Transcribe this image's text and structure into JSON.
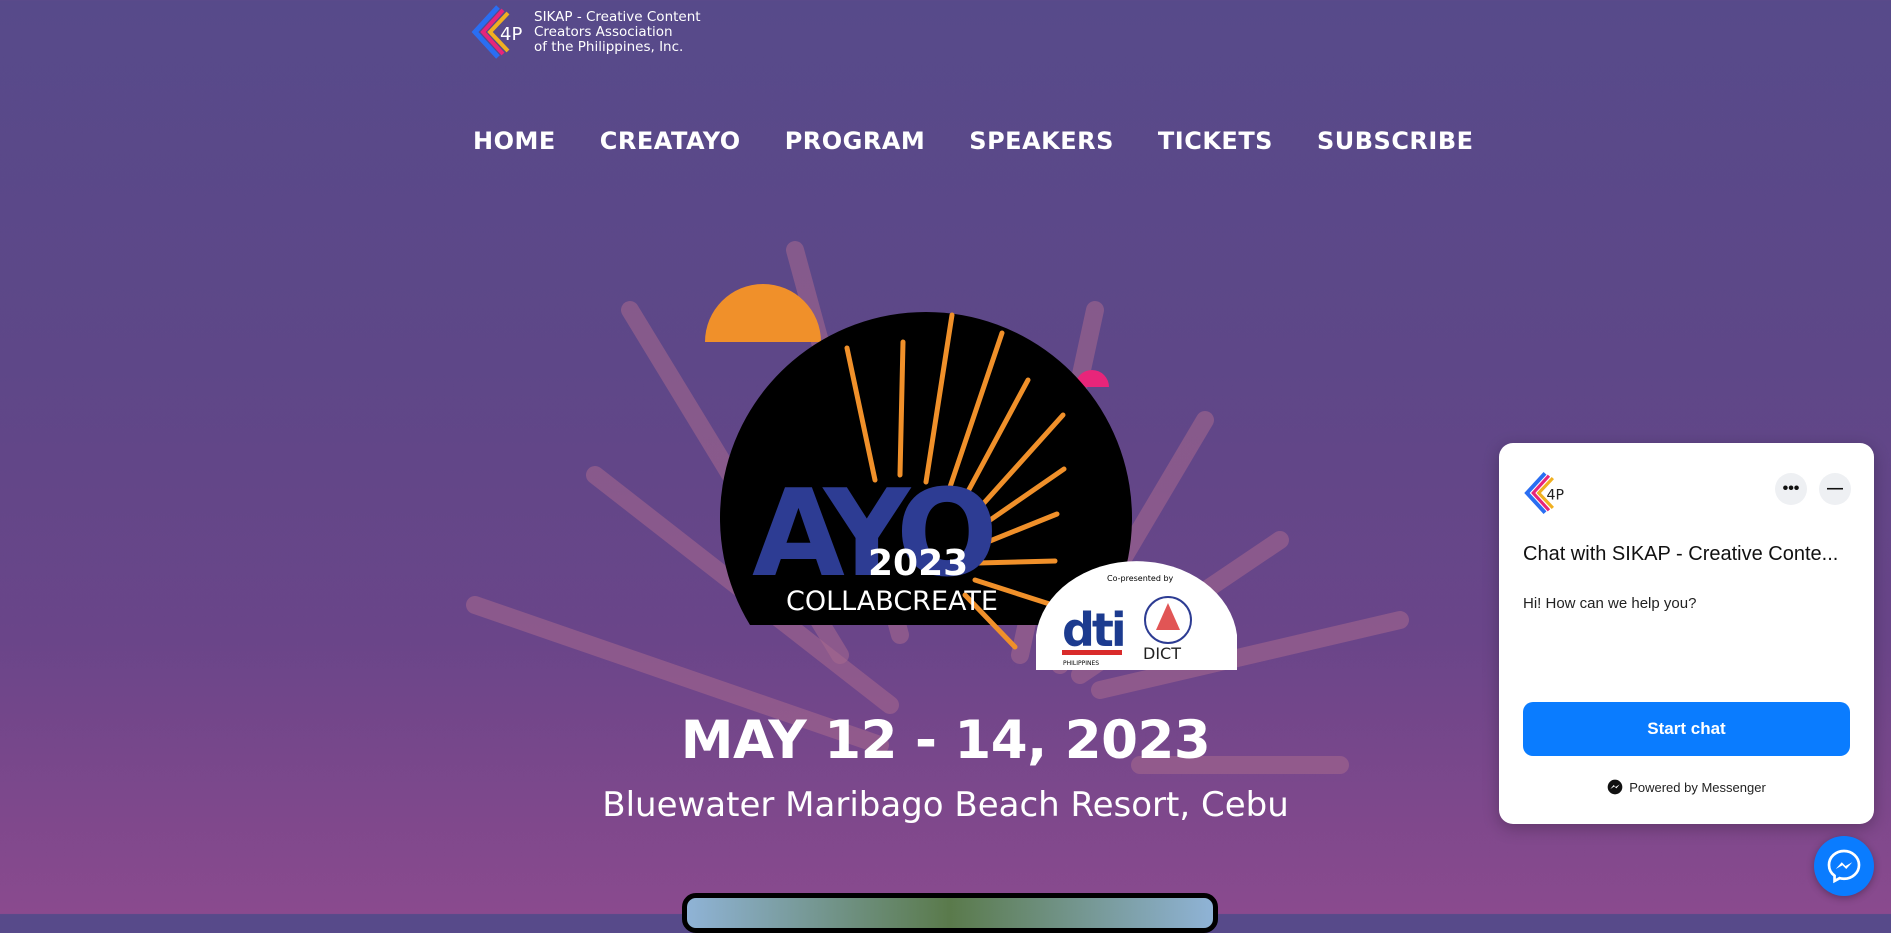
{
  "brand": {
    "line1": "SIKAP - Creative Content",
    "line2": "Creators Association",
    "line3": "of the Philippines, Inc.",
    "logo_icon": "sikap-logo-icon"
  },
  "nav": {
    "items": [
      "HOME",
      "CREATAYO",
      "PROGRAM",
      "SPEAKERS",
      "TICKETS",
      "SUBSCRIBE"
    ]
  },
  "hero": {
    "logo_word": "AYO",
    "year": "2023",
    "subtitle": "COLLABCREATE",
    "copresented": "Co-presented by",
    "partner1": "dti",
    "partner1_sub": "PHILIPPINES",
    "partner2": "DICT"
  },
  "event": {
    "date": "MAY 12 - 14, 2023",
    "venue": "Bluewater Maribago Beach Resort, Cebu"
  },
  "chat": {
    "title": "Chat with SIKAP - Creative Conte...",
    "greeting": "Hi! How can we help you?",
    "start_label": "Start chat",
    "powered": "Powered by Messenger",
    "more_label": "•••",
    "minimize_label": "—"
  },
  "colors": {
    "accent": "#0a7cff",
    "orange": "#f0902a",
    "pink": "#e8257a",
    "navy": "#2d3c93"
  }
}
